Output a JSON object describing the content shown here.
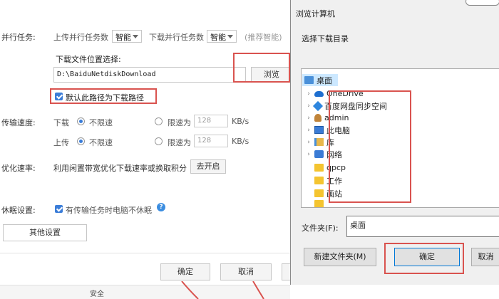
{
  "settings": {
    "parallel": {
      "label": "并行任务:",
      "upload_label": "上传并行任务数",
      "upload_value": "智能",
      "download_label": "下载并行任务数",
      "download_value": "智能",
      "hint": "(推荐智能)"
    },
    "download_location": {
      "label": "下载文件位置选择:",
      "path": "D:\\BaiduNetdiskDownload",
      "browse_button": "浏览",
      "default_checkbox": "默认此路径为下载路径",
      "default_checked": true
    },
    "speed": {
      "label": "传输速度:",
      "download_label": "下载",
      "upload_label": "上传",
      "unlimited": "不限速",
      "limit": "限速为",
      "download_limit_value": "128",
      "upload_limit_value": "128",
      "unit": "KB/s",
      "download_selected": "不限速",
      "upload_selected": "不限速"
    },
    "optimize": {
      "label": "优化速率:",
      "text": "利用闲置带宽优化下载速率或换取积分",
      "button": "去开启"
    },
    "sleep": {
      "label": "休眠设置:",
      "checkbox": "有传输任务时电脑不休眠",
      "checked": true,
      "help_icon": "?"
    },
    "other_button": "其他设置",
    "footer": {
      "ok": "确定",
      "cancel": "取消",
      "bottom_tab": "安全"
    }
  },
  "dialog": {
    "title": "浏览计算机",
    "subtitle": "选择下载目录",
    "tree": [
      {
        "label": "桌面",
        "icon": "folder-blue-icon",
        "selected": true,
        "expandable": false
      },
      {
        "label": "OneDrive",
        "icon": "cloud-icon",
        "selected": false,
        "expandable": true
      },
      {
        "label": "百度网盘同步空间",
        "icon": "sync-icon",
        "selected": false,
        "expandable": true
      },
      {
        "label": "admin",
        "icon": "person-icon",
        "selected": false,
        "expandable": true
      },
      {
        "label": "此电脑",
        "icon": "computer-icon",
        "selected": false,
        "expandable": true
      },
      {
        "label": "库",
        "icon": "library-icon",
        "selected": false,
        "expandable": true
      },
      {
        "label": "网络",
        "icon": "network-icon",
        "selected": false,
        "expandable": true
      },
      {
        "label": "qpcp",
        "icon": "folder-icon",
        "selected": false,
        "expandable": false
      },
      {
        "label": "工作",
        "icon": "folder-icon",
        "selected": false,
        "expandable": false
      },
      {
        "label": "画站",
        "icon": "folder-icon",
        "selected": false,
        "expandable": false
      }
    ],
    "folder_label": "文件夹(F):",
    "folder_value": "桌面",
    "new_folder_button": "新建文件夹(M)",
    "ok_button": "确定",
    "cancel_button": "取消"
  },
  "colors": {
    "annotation_red": "#d9534f",
    "selection_blue": "#cce8ff",
    "accent": "#3b7dd8"
  }
}
